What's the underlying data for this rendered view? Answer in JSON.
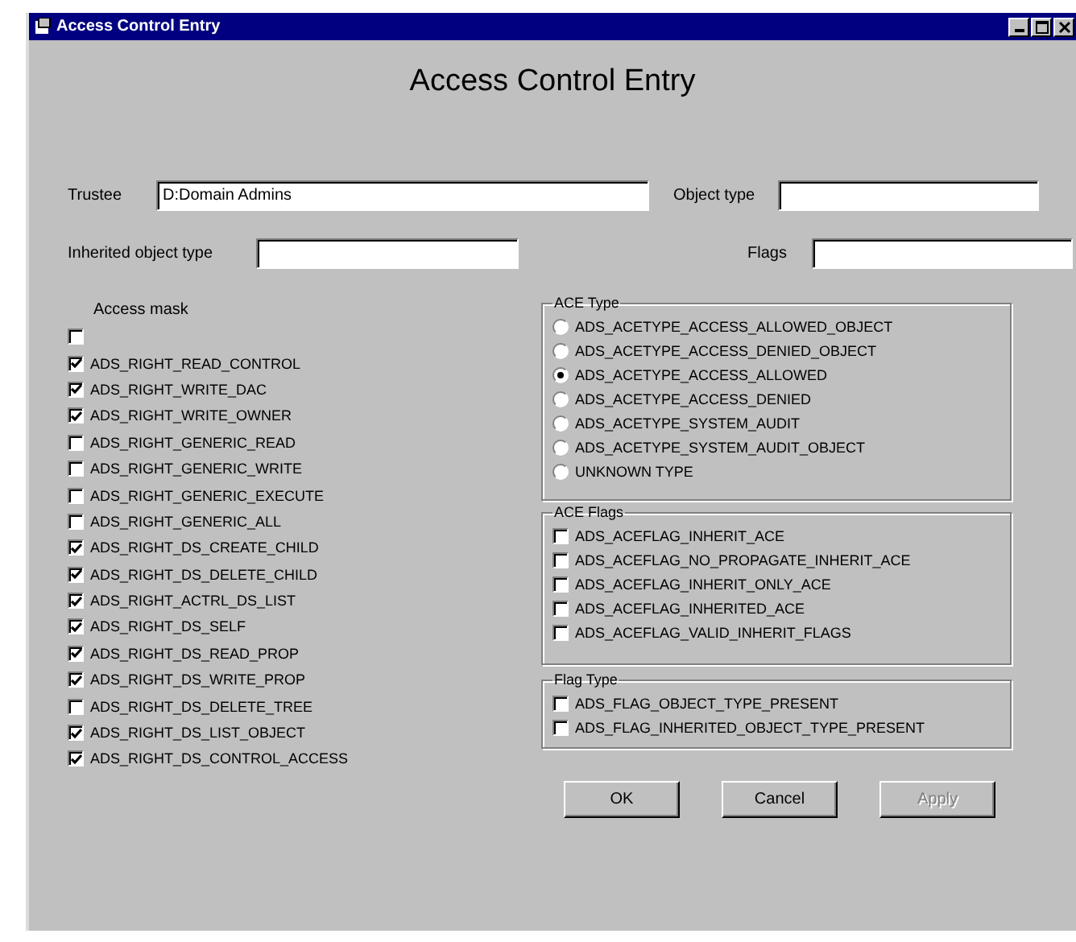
{
  "window": {
    "title": "Access Control Entry"
  },
  "heading": "Access Control Entry",
  "fields": {
    "trustee": {
      "label": "Trustee",
      "value": "D:Domain Admins"
    },
    "object_type": {
      "label": "Object type"
    },
    "inherited_object_type": {
      "label": "Inherited object type"
    },
    "flags": {
      "label": "Flags"
    }
  },
  "access_mask": {
    "label": "Access mask",
    "items": [
      {
        "checked": false
      },
      {
        "label": "ADS_RIGHT_READ_CONTROL",
        "checked": true
      },
      {
        "label": "ADS_RIGHT_WRITE_DAC",
        "checked": true
      },
      {
        "label": "ADS_RIGHT_WRITE_OWNER",
        "checked": true
      },
      {
        "label": "ADS_RIGHT_GENERIC_READ",
        "checked": false
      },
      {
        "label": "ADS_RIGHT_GENERIC_WRITE",
        "checked": false
      },
      {
        "label": "ADS_RIGHT_GENERIC_EXECUTE",
        "checked": false
      },
      {
        "label": "ADS_RIGHT_GENERIC_ALL",
        "checked": false
      },
      {
        "label": "ADS_RIGHT_DS_CREATE_CHILD",
        "checked": true
      },
      {
        "label": "ADS_RIGHT_DS_DELETE_CHILD",
        "checked": true
      },
      {
        "label": "ADS_RIGHT_ACTRL_DS_LIST",
        "checked": true
      },
      {
        "label": "ADS_RIGHT_DS_SELF",
        "checked": true
      },
      {
        "label": "ADS_RIGHT_DS_READ_PROP",
        "checked": true
      },
      {
        "label": "ADS_RIGHT_DS_WRITE_PROP",
        "checked": true
      },
      {
        "label": "ADS_RIGHT_DS_DELETE_TREE",
        "checked": false
      },
      {
        "label": "ADS_RIGHT_DS_LIST_OBJECT",
        "checked": true
      },
      {
        "label": "ADS_RIGHT_DS_CONTROL_ACCESS",
        "checked": true
      }
    ]
  },
  "ace_type": {
    "label": "ACE Type",
    "options": [
      {
        "label": "ADS_ACETYPE_ACCESS_ALLOWED_OBJECT",
        "selected": false
      },
      {
        "label": "ADS_ACETYPE_ACCESS_DENIED_OBJECT",
        "selected": false
      },
      {
        "label": "ADS_ACETYPE_ACCESS_ALLOWED",
        "selected": true
      },
      {
        "label": "ADS_ACETYPE_ACCESS_DENIED",
        "selected": false
      },
      {
        "label": "ADS_ACETYPE_SYSTEM_AUDIT",
        "selected": false
      },
      {
        "label": "ADS_ACETYPE_SYSTEM_AUDIT_OBJECT",
        "selected": false
      },
      {
        "label": "UNKNOWN TYPE",
        "selected": false
      }
    ]
  },
  "ace_flags": {
    "label": "ACE Flags",
    "items": [
      {
        "label": "ADS_ACEFLAG_INHERIT_ACE",
        "checked": false
      },
      {
        "label": "ADS_ACEFLAG_NO_PROPAGATE_INHERIT_ACE",
        "checked": false
      },
      {
        "label": "ADS_ACEFLAG_INHERIT_ONLY_ACE",
        "checked": false
      },
      {
        "label": "ADS_ACEFLAG_INHERITED_ACE",
        "checked": false
      },
      {
        "label": "ADS_ACEFLAG_VALID_INHERIT_FLAGS",
        "checked": false
      }
    ]
  },
  "flag_type": {
    "label": "Flag Type",
    "items": [
      {
        "label": "ADS_FLAG_OBJECT_TYPE_PRESENT",
        "checked": false
      },
      {
        "label": "ADS_FLAG_INHERITED_OBJECT_TYPE_PRESENT",
        "checked": false
      }
    ]
  },
  "buttons": [
    {
      "label": "OK",
      "disabled": false
    },
    {
      "label": "Cancel",
      "disabled": false
    },
    {
      "label": "Apply",
      "disabled": true
    }
  ]
}
